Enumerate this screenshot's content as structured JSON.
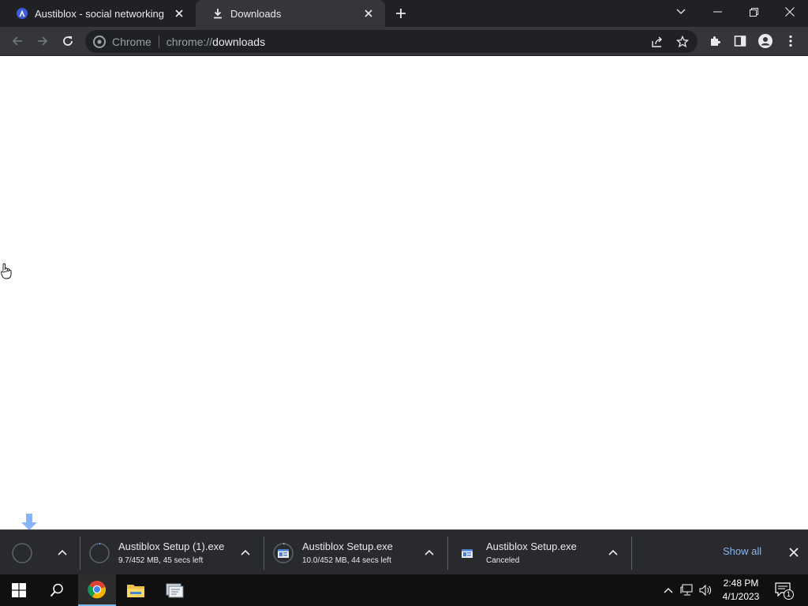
{
  "browser": {
    "tabs": [
      {
        "title": "Austiblox - social networking",
        "active": false,
        "icon": "austiblox-favicon"
      },
      {
        "title": "Downloads",
        "active": true,
        "icon": "download-icon"
      }
    ],
    "omnibox": {
      "site_label": "Chrome",
      "url_scheme": "chrome://",
      "url_host": "downloads"
    }
  },
  "download_shelf": {
    "items": [
      {
        "filename": "Austiblox Setup (1).exe",
        "status": "9.7/452 MB, 45 secs left",
        "icon": "progress-ring-icon"
      },
      {
        "filename": "Austiblox Setup.exe",
        "status": "10.0/452 MB, 44 secs left",
        "icon": "installer-file-icon"
      },
      {
        "filename": "Austiblox Setup.exe",
        "status": "Canceled",
        "icon": "installer-file-icon"
      }
    ],
    "show_all_label": "Show all"
  },
  "taskbar": {
    "time": "2:48 PM",
    "date": "4/1/2023",
    "notification_count": "1"
  },
  "colors": {
    "tabstrip": "#202124",
    "toolbar": "#35363a",
    "shelf": "#292a2d",
    "link": "#8ab4f8",
    "taskbar": "#101010"
  }
}
